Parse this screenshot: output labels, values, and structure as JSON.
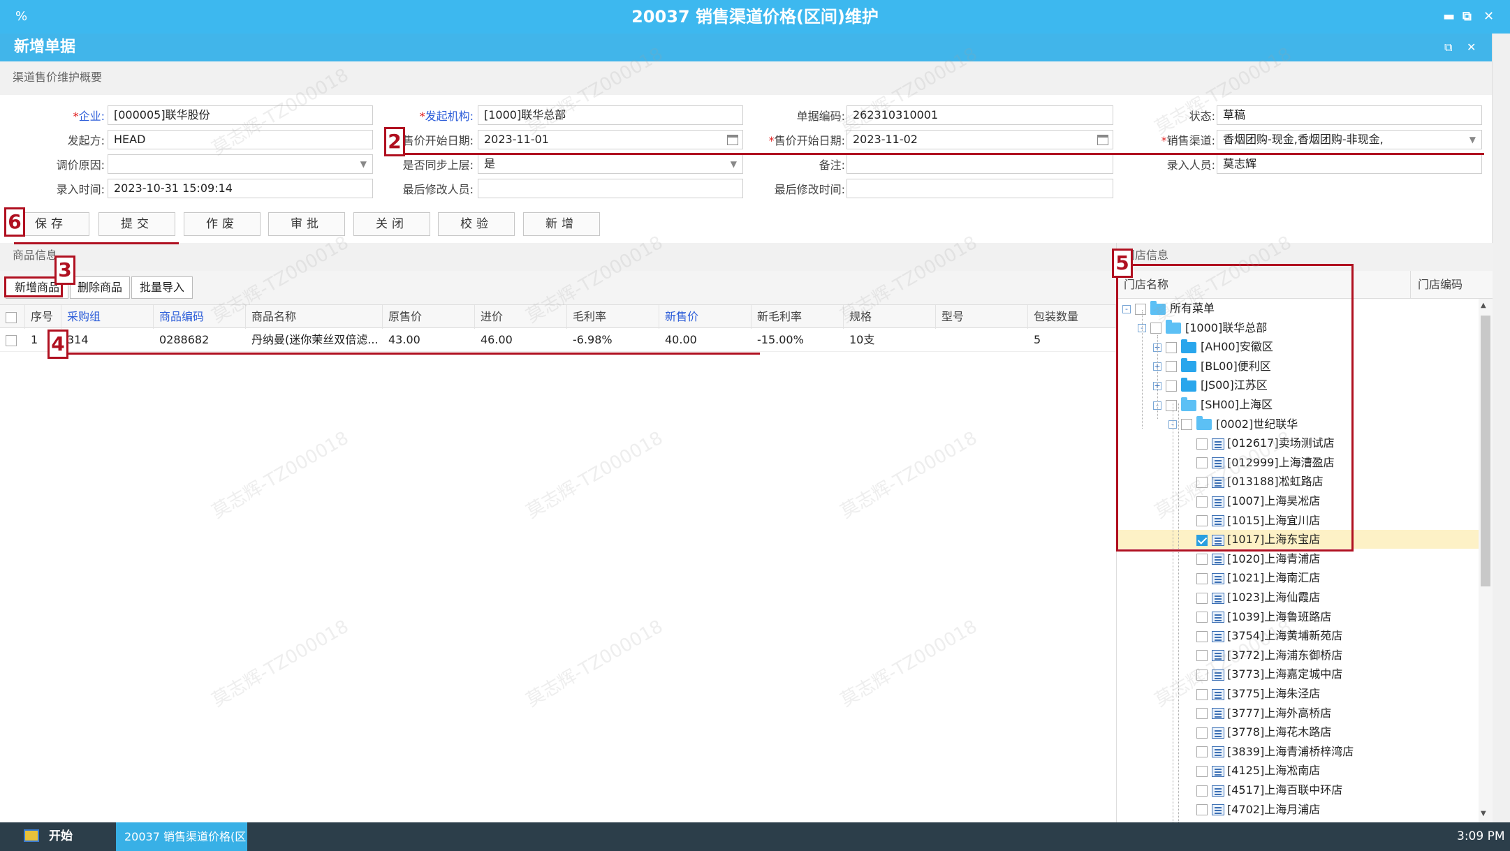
{
  "window": {
    "app_title": "20037 销售渠道价格(区间)维护",
    "pct_icon": "%",
    "controls": [
      "minimize-icon",
      "restore-icon",
      "close-icon"
    ]
  },
  "dialog": {
    "title": "新增单据"
  },
  "summary_section": {
    "title": "渠道售价维护概要"
  },
  "form": {
    "enterprise_label": "企业:",
    "enterprise_value": "[000005]联华股份",
    "initiator_org_label": "发起机构:",
    "initiator_org_value": "[1000]联华总部",
    "doc_code_label": "单据编码:",
    "doc_code_value": "262310310001",
    "status_label": "状态:",
    "status_value": "草稿",
    "initiator_label": "发起方:",
    "initiator_value": "HEAD",
    "sale_start_date1_label": "售价开始日期:",
    "sale_start_date1_value": "2023-11-01",
    "sale_start_date2_label": "售价开始日期:",
    "sale_start_date2_value": "2023-11-02",
    "sales_channel_label": "销售渠道:",
    "sales_channel_value": "香烟团购-现金,香烟团购-非现金,",
    "reason_label": "调价原因:",
    "reason_value": "",
    "sync_label": "是否同步上层:",
    "sync_value": "是",
    "remark_label": "备注:",
    "remark_value": "",
    "entry_user_label": "录入人员:",
    "entry_user_value": "莫志辉",
    "entry_time_label": "录入时间:",
    "entry_time_value": "2023-10-31 15:09:14",
    "last_modifier_label": "最后修改人员:",
    "last_modifier_value": "",
    "last_modified_time_label": "最后修改时间:",
    "last_modified_time_value": ""
  },
  "actions": [
    "保存",
    "提交",
    "作废",
    "审批",
    "关闭",
    "校验",
    "新增"
  ],
  "goods_section": {
    "title": "商品信息",
    "toolbar": [
      "新增商品",
      "删除商品",
      "批量导入"
    ],
    "columns": [
      "序号",
      "采购组",
      "商品编码",
      "商品名称",
      "原售价",
      "进价",
      "毛利率",
      "新售价",
      "新毛利率",
      "规格",
      "型号",
      "包装数量"
    ],
    "rows": [
      [
        "1",
        "314",
        "0288682",
        "丹纳曼(迷你茉丝双倍滤...",
        "43.00",
        "46.00",
        "-6.98%",
        "40.00",
        "-15.00%",
        "10支",
        "",
        "5"
      ]
    ]
  },
  "store_section": {
    "title": "门店信息",
    "columns": [
      "门店名称",
      "门店编码"
    ],
    "tree": [
      {
        "label": "所有菜单",
        "type": "folder-open",
        "exp": "-",
        "level": 0,
        "checked": false
      },
      {
        "label": "[1000]联华总部",
        "type": "folder-open",
        "exp": "-",
        "level": 1,
        "checked": false
      },
      {
        "label": "[AH00]安徽区",
        "type": "folder",
        "exp": "+",
        "level": 2,
        "checked": false
      },
      {
        "label": "[BL00]便利区",
        "type": "folder",
        "exp": "+",
        "level": 2,
        "checked": false
      },
      {
        "label": "[JS00]江苏区",
        "type": "folder",
        "exp": "+",
        "level": 2,
        "checked": false
      },
      {
        "label": "[SH00]上海区",
        "type": "folder-open",
        "exp": "-",
        "level": 2,
        "checked": false
      },
      {
        "label": "[0002]世纪联华",
        "type": "folder-open",
        "exp": "-",
        "level": 3,
        "checked": false
      },
      {
        "label": "[012617]卖场测试店",
        "type": "leaf",
        "level": 4,
        "checked": false
      },
      {
        "label": "[012999]上海漕盈店",
        "type": "leaf",
        "level": 4,
        "checked": false
      },
      {
        "label": "[013188]凇虹路店",
        "type": "leaf",
        "level": 4,
        "checked": false
      },
      {
        "label": "[1007]上海昊凇店",
        "type": "leaf",
        "level": 4,
        "checked": false
      },
      {
        "label": "[1015]上海宜川店",
        "type": "leaf",
        "level": 4,
        "checked": false
      },
      {
        "label": "[1017]上海东宝店",
        "type": "leaf",
        "level": 4,
        "checked": true
      },
      {
        "label": "[1020]上海青浦店",
        "type": "leaf",
        "level": 4,
        "checked": false
      },
      {
        "label": "[1021]上海南汇店",
        "type": "leaf",
        "level": 4,
        "checked": false
      },
      {
        "label": "[1023]上海仙霞店",
        "type": "leaf",
        "level": 4,
        "checked": false
      },
      {
        "label": "[1039]上海鲁班路店",
        "type": "leaf",
        "level": 4,
        "checked": false
      },
      {
        "label": "[3754]上海黄埔新苑店",
        "type": "leaf",
        "level": 4,
        "checked": false
      },
      {
        "label": "[3772]上海浦东御桥店",
        "type": "leaf",
        "level": 4,
        "checked": false
      },
      {
        "label": "[3773]上海嘉定城中店",
        "type": "leaf",
        "level": 4,
        "checked": false
      },
      {
        "label": "[3775]上海朱泾店",
        "type": "leaf",
        "level": 4,
        "checked": false
      },
      {
        "label": "[3777]上海外高桥店",
        "type": "leaf",
        "level": 4,
        "checked": false
      },
      {
        "label": "[3778]上海花木路店",
        "type": "leaf",
        "level": 4,
        "checked": false
      },
      {
        "label": "[3839]上海青浦桥梓湾店",
        "type": "leaf",
        "level": 4,
        "checked": false
      },
      {
        "label": "[4125]上海凇南店",
        "type": "leaf",
        "level": 4,
        "checked": false
      },
      {
        "label": "[4517]上海百联中环店",
        "type": "leaf",
        "level": 4,
        "checked": false
      },
      {
        "label": "[4702]上海月浦店",
        "type": "leaf",
        "level": 4,
        "checked": false
      }
    ]
  },
  "markers": [
    "6",
    "2",
    "3",
    "4",
    "5"
  ],
  "watermark_text": "莫志辉-TZ000018",
  "taskbar": {
    "start_label": "开始",
    "task_label": "20037 销售渠道价格(区",
    "clock": "3:09 PM"
  },
  "colors": {
    "title_bar": "#3db8ef",
    "annotation_red": "#b01020",
    "link_blue": "#2f5fd9",
    "taskbar": "#2c3e4a"
  }
}
